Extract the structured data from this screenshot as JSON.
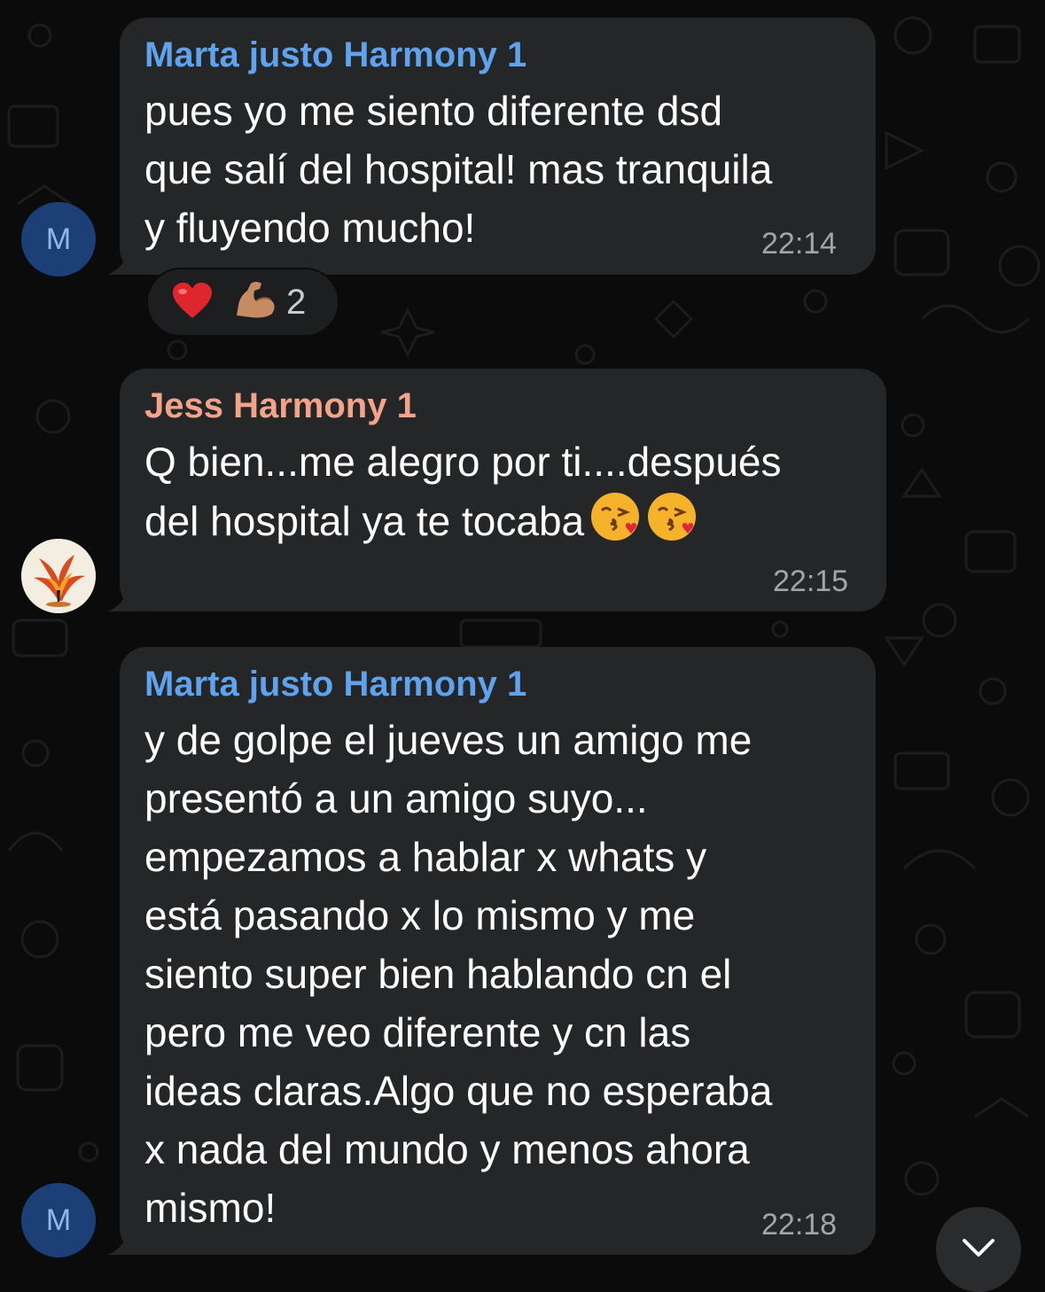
{
  "chat": {
    "messages": [
      {
        "sender": "Marta justo Harmony 1",
        "sender_color": "#5fa2ee",
        "avatar_initial": "M",
        "text": "pues yo me siento diferente  dsd\nque salí del hospital! mas tranquila\ny fluyendo mucho!",
        "time": "22:14",
        "reactions": {
          "emojis": [
            "heart",
            "flexed-biceps"
          ],
          "count": "2"
        }
      },
      {
        "sender": "Jess Harmony 1",
        "sender_color": "#f2a48a",
        "avatar_image": "phoenix-avatar",
        "text": "Q bien...me alegro por ti....después\ndel hospital ya te tocaba",
        "emojis": [
          "kiss-face",
          "kiss-face"
        ],
        "time": "22:15"
      },
      {
        "sender": "Marta justo Harmony 1",
        "sender_color": "#5fa2ee",
        "avatar_initial": "M",
        "text": "y de golpe el jueves un amigo me\npresentó a un amigo suyo...\nempezamos a hablar x whats y\nestá pasando x lo mismo y me\nsiento super bien hablando cn el\npero me veo diferente y cn las\nideas claras.Algo que no esperaba\nx nada del mundo y menos ahora\nmismo!",
        "time": "22:18"
      }
    ],
    "scroll_down_icon": "chevron-down-icon"
  },
  "colors": {
    "background": "#0b0b0c",
    "bubble": "#252627",
    "timestamp": "#a3a4a8"
  }
}
